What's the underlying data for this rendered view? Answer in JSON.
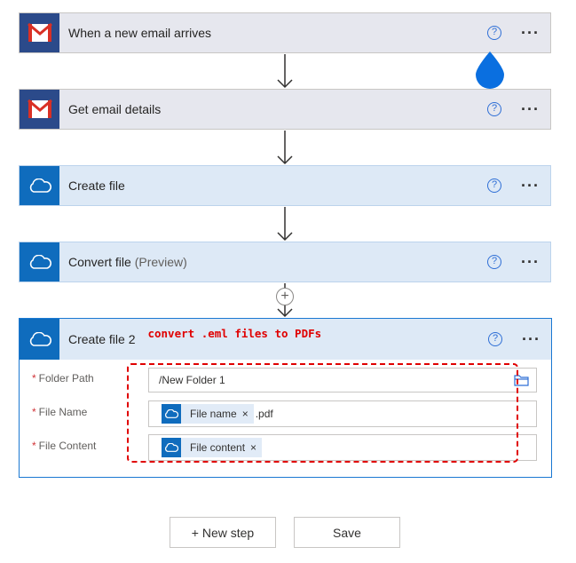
{
  "flow": {
    "steps": [
      {
        "title": "When a new email arrives",
        "connector": "gmail"
      },
      {
        "title": "Get email details",
        "connector": "gmail"
      },
      {
        "title": "Create file",
        "connector": "onedrive"
      },
      {
        "title": "Convert file",
        "title_suffix": "(Preview)",
        "connector": "onedrive"
      }
    ],
    "help_glyph": "?",
    "more_glyph": "···",
    "add_glyph": "+"
  },
  "expanded": {
    "title": "Create file 2",
    "annotation": "convert .eml files to PDFs",
    "fields": {
      "folder_path": {
        "label": "Folder Path",
        "value": "/New Folder 1"
      },
      "file_name": {
        "label": "File Name",
        "token": "File name",
        "suffix": ".pdf"
      },
      "file_content": {
        "label": "File Content",
        "token": "File content"
      }
    },
    "required_marker": "*",
    "token_remove": "×"
  },
  "footer": {
    "new_step": "+ New step",
    "save": "Save"
  },
  "colors": {
    "gmail_icon_bg": "#2b4a8a",
    "onedrive_icon_bg": "#0f6cbd",
    "accent": "#1a78d2",
    "annotation": "#e00000",
    "drop_marker": "#0a6fe0"
  },
  "icons": [
    "gmail-icon",
    "onedrive-cloud-icon",
    "help-icon",
    "more-icon",
    "folder-icon",
    "arrow-down-icon",
    "add-icon"
  ]
}
